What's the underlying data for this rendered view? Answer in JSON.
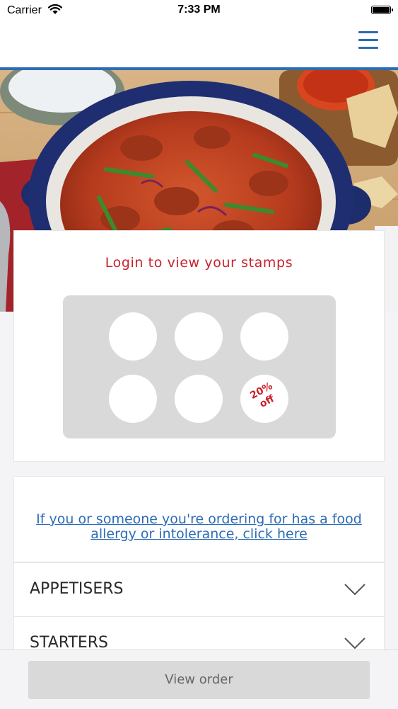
{
  "status_bar": {
    "carrier": "Carrier",
    "time": "7:33 PM"
  },
  "loyalty": {
    "title": "Login to view your stamps",
    "stamps_total": 6,
    "reward_line1": "20%",
    "reward_line2": "off"
  },
  "allergy": {
    "link_text": "If you or someone you're ordering for has a food allergy or intolerance, click here"
  },
  "menu_categories": [
    {
      "label": "APPETISERS"
    },
    {
      "label": "STARTERS"
    }
  ],
  "bottom": {
    "view_order_label": "View order"
  },
  "colors": {
    "brand_blue": "#2c6cb6",
    "accent_red": "#c8222c",
    "disabled_gray": "#d9d9d9"
  }
}
